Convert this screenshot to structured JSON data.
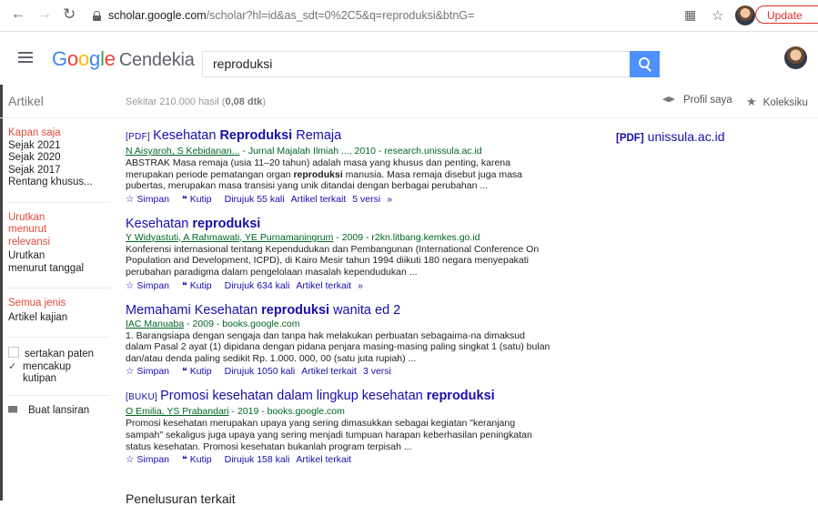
{
  "browser": {
    "url_host": "scholar.google.com",
    "url_path": "/scholar?hl=id&as_sdt=0%2C5&q=reproduksi&btnG=",
    "update_label": "Update"
  },
  "header": {
    "logo_text": "Google",
    "product_name": "Cendekia",
    "query": "reproduksi"
  },
  "subbar": {
    "section": "Artikel",
    "stats_prefix": "Sekitar 210.000 hasil (",
    "stats_time": "0,08 dtk",
    "stats_suffix": ")",
    "profile_label": "Profil saya",
    "library_label": "Koleksiku"
  },
  "sidebar": {
    "time": [
      "Kapan saja",
      "Sejak 2021",
      "Sejak 2020",
      "Sejak 2017",
      "Rentang khusus..."
    ],
    "sort": [
      "Urutkan menurut relevansi",
      "Urutkan menurut tanggal"
    ],
    "type": [
      "Semua jenis",
      "Artikel kajian"
    ],
    "patents_label": "sertakan paten",
    "citations_label": "mencakup kutipan",
    "alert_label": "Buat lansiran"
  },
  "results": [
    {
      "tag": "[PDF]",
      "title_pre": "Kesehatan ",
      "title_bold": "Reproduksi",
      "title_post": " Remaja",
      "authors": "N Aisyaroh, S Kebidanan...",
      "source": " - Jurnal Majalah Ilmiah ..., 2010 - research.unissula.ac.id",
      "snippet": "ABSTRAK Masa remaja (usia 11–20 tahun) adalah masa yang khusus dan penting, karena merupakan periode pematangan organ reproduksi manusia. Masa remaja disebut juga masa pubertas, merupakan masa transisi yang unik ditandai dengan berbagai perubahan ...",
      "save": "Simpan",
      "cite": "Kutip",
      "cited": "Dirujuk 55 kali",
      "related": "Artikel terkait",
      "versions": "5 versi"
    },
    {
      "tag": "",
      "title_pre": "Kesehatan ",
      "title_bold": "reproduksi",
      "title_post": "",
      "authors": "Y Widyastuti, A Rahmawati, YE Purnamaningrum",
      "source": " - 2009 - r2kn.litbang.kemkes.go.id",
      "snippet": "Konferensi internasional tentang Kependudukan dan Pembangunan (International Conference On Population and Development, ICPD), di Kairo Mesir tahun 1994 diikuti 180 negara menyepakati perubahan paradigma dalam pengelolaan masalah kependudukan ...",
      "save": "Simpan",
      "cite": "Kutip",
      "cited": "Dirujuk 634 kali",
      "related": "Artikel terkait",
      "versions": ""
    },
    {
      "tag": "",
      "title_pre": "Memahami Kesehatan ",
      "title_bold": "reproduksi",
      "title_post": " wanita ed 2",
      "authors": "IAC Manuaba",
      "source": " - 2009 - books.google.com",
      "snippet": "1. Barangsiapa dengan sengaja dan tanpa hak melakukan perbuatan sebagaima-na dimaksud dalam Pasal 2 ayat (1) dipidana dengan pidana penjara masing-masing paling singkat 1 (satu) bulan dan/atau denda paling sedikit Rp. 1.000. 000, 00 (satu juta rupiah) ...",
      "save": "Simpan",
      "cite": "Kutip",
      "cited": "Dirujuk 1050 kali",
      "related": "Artikel terkait",
      "versions": "3 versi"
    },
    {
      "tag": "[BUKU]",
      "title_pre": "Promosi kesehatan dalam lingkup kesehatan ",
      "title_bold": "reproduksi",
      "title_post": "",
      "authors": "O Emilia, YS Prabandari",
      "source": " - 2019 - books.google.com",
      "snippet": "Promosi kesehatan merupakan upaya yang sering dimasukkan sebagai kegiatan \"keranjang sampah\" sekaligus juga upaya yang sering menjadi tumpuan harapan keberhasilan peningkatan status kesehatan. Promosi kesehatan bukanlah program terpisah ...",
      "save": "Simpan",
      "cite": "Kutip",
      "cited": "Dirujuk 158 kali",
      "related": "Artikel terkait",
      "versions": ""
    }
  ],
  "side_links": [
    {
      "tag": "[PDF]",
      "label": "unissula.ac.id"
    }
  ],
  "related_searches_title": "Penelusuran terkait"
}
